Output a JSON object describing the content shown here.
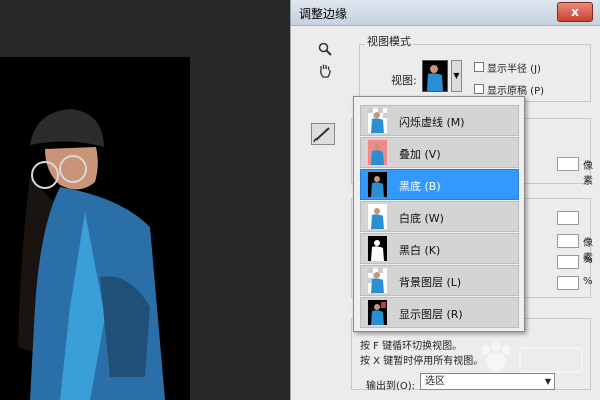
{
  "dialog": {
    "title": "调整边缘",
    "close_label": "x"
  },
  "tools": {
    "zoom_icon": "magnifier-icon",
    "hand_icon": "hand-icon",
    "brush_icon": "refine-brush-icon"
  },
  "view_mode": {
    "group_title": "视图模式",
    "view_label": "视图:",
    "show_radius_label": "显示半径 (J)",
    "show_original_label": "显示原稿 (P)"
  },
  "side_units": {
    "pixels_1": "像素",
    "pixels_2": "像素",
    "percent_1": "%",
    "percent_2": "%"
  },
  "view_menu": {
    "items": [
      {
        "label": "闪烁虚线 (M)",
        "selected": false
      },
      {
        "label": "叠加 (V)",
        "selected": false
      },
      {
        "label": "黑底 (B)",
        "selected": true
      },
      {
        "label": "白底 (W)",
        "selected": false
      },
      {
        "label": "黑白 (K)",
        "selected": false
      },
      {
        "label": "背景图层 (L)",
        "selected": false
      },
      {
        "label": "显示图层 (R)",
        "selected": false
      }
    ],
    "hint_1": "按 F 键循环切换视图。",
    "hint_2": "按 X 键暂时停用所有视图。"
  },
  "output": {
    "label": "输出到(O):",
    "value": "选区"
  },
  "colors": {
    "selected_row": "#3399ff",
    "close_button": "#c8412d",
    "arrow": "#e0261b"
  }
}
